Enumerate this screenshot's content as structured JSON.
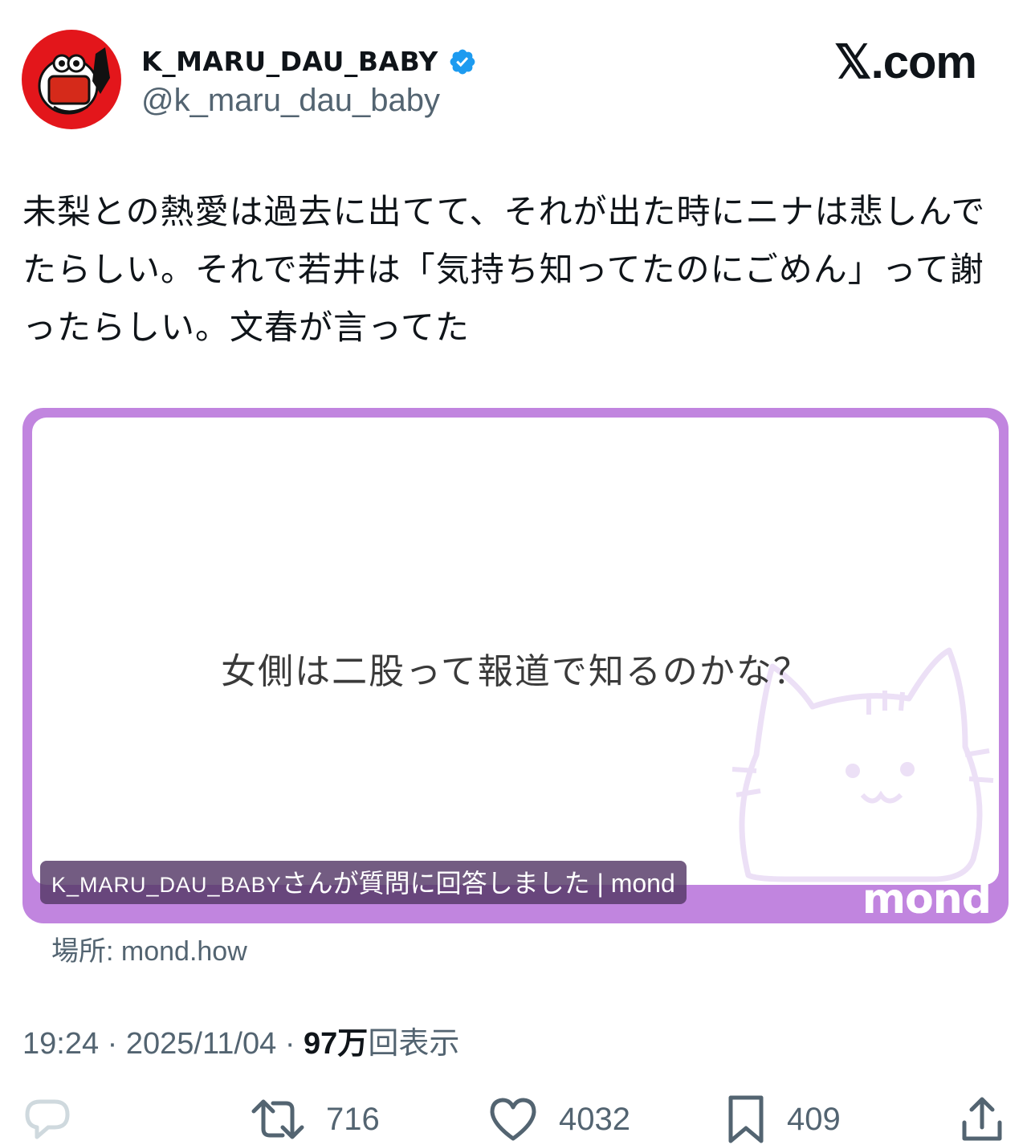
{
  "user": {
    "display_name": "K_MARU_DAU_BABY",
    "handle": "@k_maru_dau_baby",
    "verified_icon": "verified-badge-icon",
    "avatar": "mascot-avatar"
  },
  "brand": "𝕏.com",
  "tweet": {
    "text": "未梨との熱愛は過去に出てて、それが出た時にニナは悲しんでたらしい。それで若井は「気持ち知ってたのにごめん」って謝ったらしい。文春が言ってた"
  },
  "card": {
    "question": "女側は二股って報道で知るのかな？",
    "caption_name": "K_MARU_DAU_BABY",
    "caption_rest": "さんが質問に回答しました | mond",
    "logo": "mond",
    "source": "場所: mond.how",
    "colors": {
      "frame": "#c185df",
      "caption_bg": "#543866"
    }
  },
  "meta": {
    "time": "19:24",
    "date": "2025/11/04",
    "views_num": "97万",
    "views_label": "回表示"
  },
  "actions": {
    "reply_icon": "reply-icon",
    "retweets": "716",
    "likes": "4032",
    "bookmarks": "409",
    "share_icon": "share-icon"
  },
  "colors": {
    "accent_blue": "#1d9bf0",
    "secondary_text": "#536471"
  }
}
